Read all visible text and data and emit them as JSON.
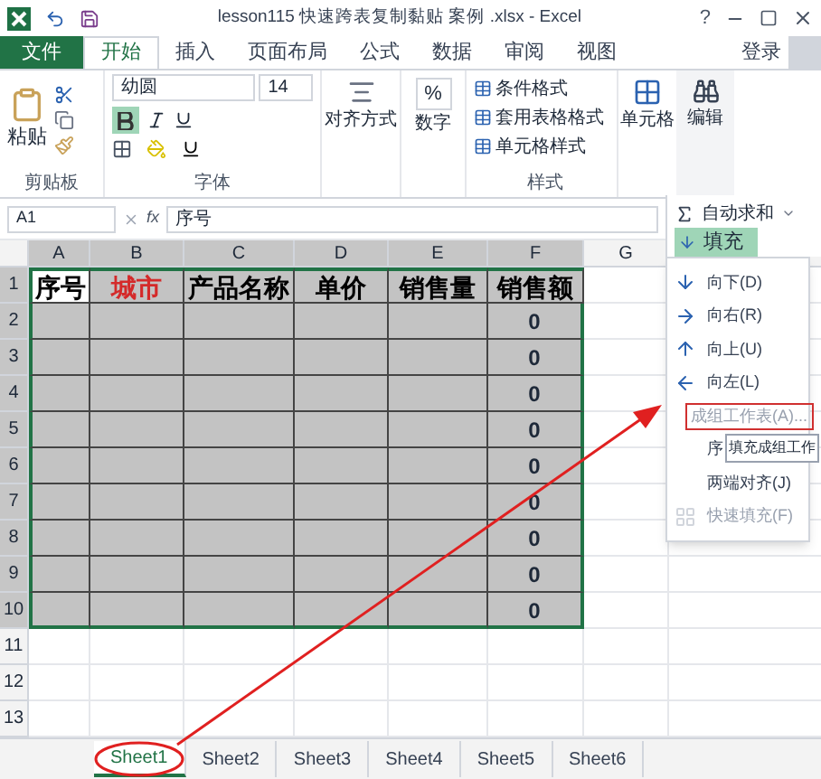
{
  "title_bar": {
    "title": "lesson115 快速跨表复制黏贴 案例 .xlsx - Excel",
    "help": "?"
  },
  "tabs": [
    {
      "label": "文件",
      "kind": "file",
      "selected": false
    },
    {
      "label": "开始",
      "kind": "tab",
      "selected": true
    },
    {
      "label": "插入",
      "kind": "tab",
      "selected": false
    },
    {
      "label": "页面布局",
      "kind": "tab",
      "selected": false
    },
    {
      "label": "公式",
      "kind": "tab",
      "selected": false
    },
    {
      "label": "数据",
      "kind": "tab",
      "selected": false
    },
    {
      "label": "审阅",
      "kind": "tab",
      "selected": false
    },
    {
      "label": "视图",
      "kind": "tab",
      "selected": false
    }
  ],
  "sign_in": "登录",
  "ribbon": {
    "clipboard": {
      "paste": "粘贴",
      "label": "剪贴板"
    },
    "font": {
      "name": "幼圆",
      "size": "14",
      "label": "字体",
      "bold": true
    },
    "alignment": {
      "label": "对齐方式"
    },
    "number": {
      "symbol": "%",
      "label": "数字"
    },
    "styles": {
      "items": [
        "条件格式",
        "套用表格格式",
        "单元格样式"
      ],
      "label": "样式"
    },
    "cells": {
      "label": "单元格"
    },
    "editing": {
      "label": "编辑"
    }
  },
  "formula_bar": {
    "name_box": "A1",
    "fx": "fx",
    "value": "序号"
  },
  "sheet": {
    "columns": [
      "A",
      "B",
      "C",
      "D",
      "E",
      "F",
      "G"
    ],
    "rows": [
      {
        "number": "1",
        "kind": "header",
        "cells": [
          {
            "text": "序号",
            "color": "#000000",
            "selected": true
          },
          {
            "text": "城市",
            "color": "#d42a2a",
            "selected": false
          },
          {
            "text": "产品名称",
            "color": "#000000",
            "selected": false
          },
          {
            "text": "单价",
            "color": "#000000",
            "selected": false
          },
          {
            "text": "销售量",
            "color": "#000000",
            "selected": false
          },
          {
            "text": "销售额",
            "color": "#000000",
            "selected": false
          }
        ]
      },
      {
        "number": "2",
        "kind": "data",
        "total": "0"
      },
      {
        "number": "3",
        "kind": "data",
        "total": "0"
      },
      {
        "number": "4",
        "kind": "data",
        "total": "0"
      },
      {
        "number": "5",
        "kind": "data",
        "total": "0"
      },
      {
        "number": "6",
        "kind": "data",
        "total": "0"
      },
      {
        "number": "7",
        "kind": "data",
        "total": "0"
      },
      {
        "number": "8",
        "kind": "data",
        "total": "0"
      },
      {
        "number": "9",
        "kind": "data",
        "total": "0"
      },
      {
        "number": "10",
        "kind": "data",
        "total": "0"
      },
      {
        "number": "11",
        "kind": "blank"
      },
      {
        "number": "12",
        "kind": "blank"
      },
      {
        "number": "13",
        "kind": "blank"
      }
    ]
  },
  "sheet_tabs": [
    {
      "label": "Sheet1",
      "selected": true
    },
    {
      "label": "Sheet2",
      "selected": false
    },
    {
      "label": "Sheet3",
      "selected": false
    },
    {
      "label": "Sheet4",
      "selected": false
    },
    {
      "label": "Sheet5",
      "selected": false
    },
    {
      "label": "Sheet6",
      "selected": false
    }
  ],
  "menu": {
    "autosum": "自动求和",
    "fill": "填充",
    "items": [
      {
        "label": "向下(D)",
        "kind": "down",
        "disabled": false
      },
      {
        "label": "向右(R)",
        "kind": "right",
        "disabled": false
      },
      {
        "label": "向上(U)",
        "kind": "up",
        "disabled": false
      },
      {
        "label": "向左(L)",
        "kind": "left",
        "disabled": false
      },
      {
        "label": "成组工作表(A)...",
        "kind": "group",
        "disabled": true
      },
      {
        "label": "序",
        "kind": "series",
        "disabled": false
      },
      {
        "label": "两端对齐(J)",
        "kind": "justify",
        "disabled": false
      },
      {
        "label": "快速填充(F)",
        "kind": "flash",
        "disabled": true
      }
    ]
  },
  "tooltip": "填充成组工作"
}
